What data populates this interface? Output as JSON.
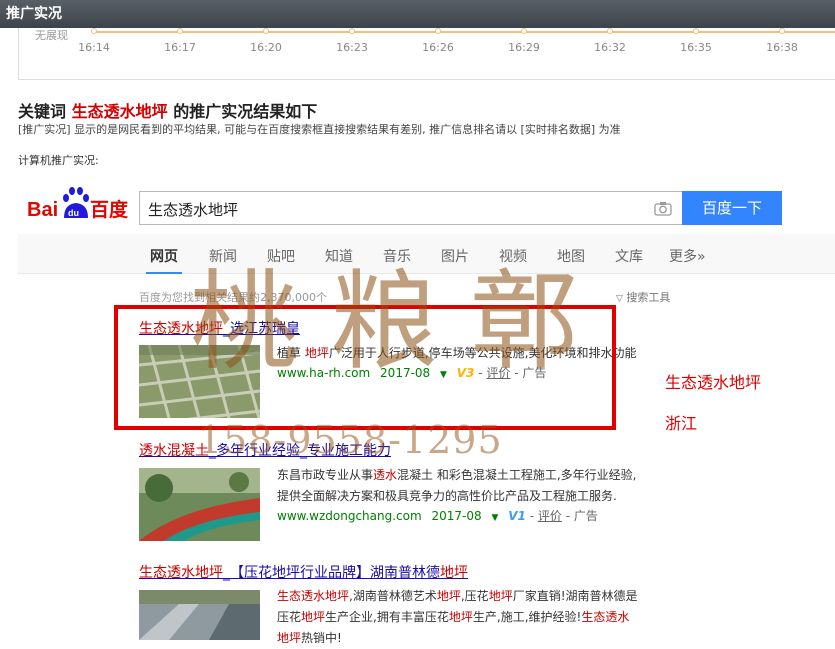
{
  "top_bar": {
    "title": "推广实况"
  },
  "timeline": {
    "no_show_label": "无展现",
    "times": [
      "16:14",
      "16:17",
      "16:20",
      "16:23",
      "16:26",
      "16:29",
      "16:32",
      "16:35",
      "16:38"
    ]
  },
  "heading": {
    "prefix": "关键词",
    "keyword": "生态透水地坪",
    "suffix": "的推广实况结果如下"
  },
  "note": "[推广实况] 显示的是网民看到的平均结果, 可能与在百度搜索框直接搜索结果有差别, 推广信息排名请以 [实时排名数据] 为准",
  "pc_label": "计算机推广实况:",
  "baidu": {
    "logo_left": "Bai",
    "logo_paw": "du",
    "logo_right": "百度",
    "search_value": "生态透水地坪",
    "search_button": "百度一下",
    "tabs": [
      "网页",
      "新闻",
      "贴吧",
      "知道",
      "音乐",
      "图片",
      "视频",
      "地图",
      "文库",
      "更多»"
    ],
    "result_count": "百度为您找到相关结果约2,370,000个",
    "tools": "搜索工具"
  },
  "ads": [
    {
      "title_hl": "生态透水地坪",
      "title_rest": "_选江苏瑞皇",
      "desc_1": "植草",
      "desc_hl1": "地坪",
      "desc_2": "广泛用于人行步道,停车场等公共设施,美化环境和排水功能",
      "url": "www.ha-rh.com",
      "date": "2017-08",
      "badge": "V3",
      "review": "评价",
      "ad_label": "广告"
    },
    {
      "title_hl": "透水混凝土",
      "title_rest": "_多年行业经验_专业施工能力",
      "desc_a": "东昌市政专业从事",
      "desc_hl1": "透水",
      "desc_b": "混凝土 和彩色混凝土工程施工,多年行业经验,",
      "desc_c": "提供全面解决方案和极具竞争力的高性价比产品及工程施工服务.",
      "url": "www.wzdongchang.com",
      "date": "2017-08",
      "badge": "V1",
      "review": "评价",
      "ad_label": "广告"
    },
    {
      "title_hl": "生态透水地坪",
      "title_mid": "_【压花地坪行业品牌】湖南普林德",
      "title_hl2": "地坪",
      "desc_hl1": "生态透水地坪",
      "desc_a": ",湖南普林德艺术",
      "desc_hl2": "地坪",
      "desc_b": ",压花",
      "desc_hl3": "地坪",
      "desc_c": "厂家直销!湖南普林德是",
      "desc_d": "压花",
      "desc_hl4": "地坪",
      "desc_e": "生产企业,拥有丰富压花",
      "desc_hl5": "地坪",
      "desc_f": "生产,施工,维护经验!",
      "desc_hl6": "生态透水",
      "desc_hl7": "地坪",
      "desc_g": "热销中!"
    }
  ],
  "side_notes": {
    "keyword": "生态透水地坪",
    "region": "浙江"
  },
  "watermark": {
    "seal": "桃粮鄣",
    "phone": "158-9558-1295"
  },
  "colors": {
    "highlight_red": "#e00000",
    "keyword_red": "#d40000",
    "baidu_blue": "#3385ff",
    "link_blue": "#1a0dab",
    "url_green": "#008000"
  }
}
